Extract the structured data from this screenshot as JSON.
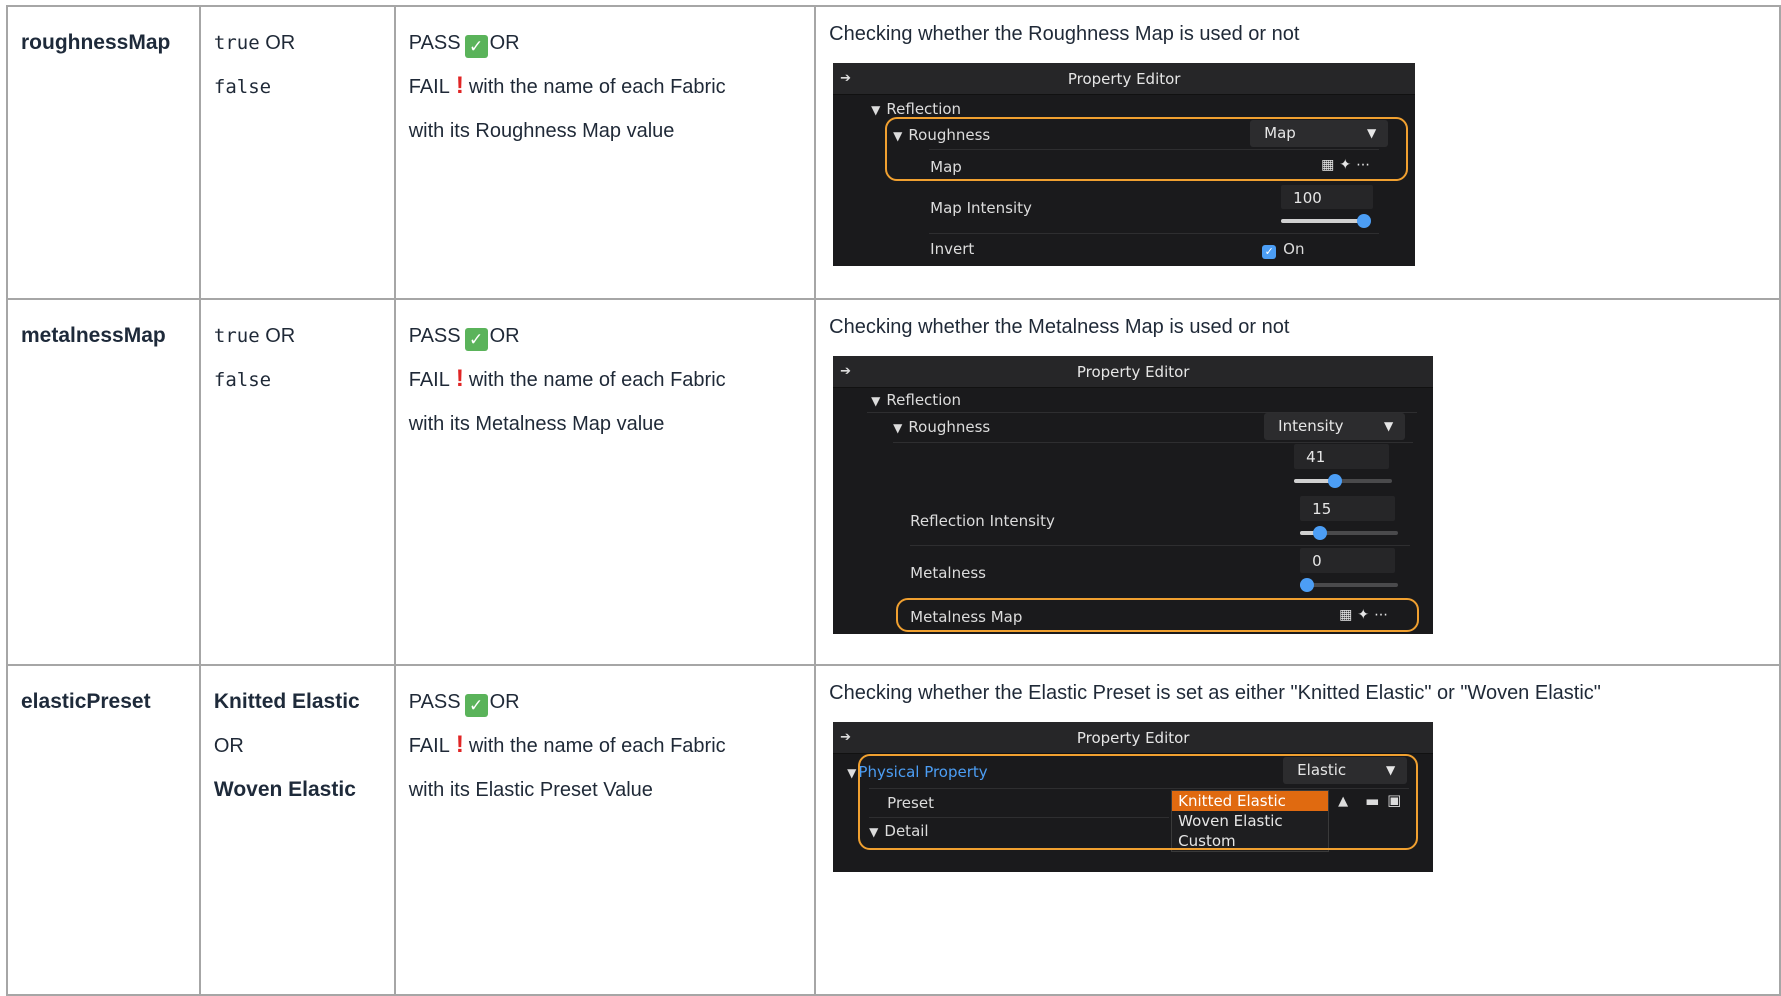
{
  "rows": [
    {
      "param": "roughnessMap",
      "values": [
        "true",
        "false"
      ],
      "or": "OR",
      "pass_label": "PASS",
      "fail_label": "FAIL",
      "result_line1_tail": "OR",
      "result_line2_tail": "with the name of each Fabric",
      "result_line3": "with its Roughness Map value",
      "description": "Checking whether the Roughness Map is used or not",
      "editor": {
        "title": "Property Editor",
        "reflection": "Reflection",
        "roughness": "Roughness",
        "roughness_mode": "Map",
        "map": "Map",
        "map_intensity": "Map Intensity",
        "map_intensity_value": "100",
        "map_intensity_level": 1.0,
        "invert": "Invert",
        "invert_state": "On"
      }
    },
    {
      "param": "metalnessMap",
      "values": [
        "true",
        "false"
      ],
      "or": "OR",
      "pass_label": "PASS",
      "fail_label": "FAIL",
      "result_line1_tail": "OR",
      "result_line2_tail": "with the name of each Fabric",
      "result_line3": "with its Metalness Map value",
      "description": "Checking whether the Metalness Map is used or not",
      "editor": {
        "title": "Property Editor",
        "reflection": "Reflection",
        "roughness": "Roughness",
        "roughness_mode": "Intensity",
        "roughness_value": "41",
        "roughness_level": 0.41,
        "reflection_intensity": "Reflection Intensity",
        "reflection_intensity_value": "15",
        "reflection_intensity_level": 0.15,
        "metalness": "Metalness",
        "metalness_value": "0",
        "metalness_level": 0.0,
        "metalness_map": "Metalness Map"
      }
    },
    {
      "param": "elasticPreset",
      "value1": "Knitted Elastic",
      "or": "OR",
      "value2": "Woven Elastic",
      "pass_label": "PASS",
      "fail_label": "FAIL",
      "result_line1_tail": "OR",
      "result_line2_tail": "with the name of each Fabric",
      "result_line3": "with its Elastic Preset Value",
      "description": "Checking whether the Elastic Preset  is set as either \"Knitted Elastic\" or \"Woven Elastic\"",
      "editor": {
        "title": "Property Editor",
        "physical_property": "Physical Property",
        "physical_mode": "Elastic",
        "preset": "Preset",
        "detail": "Detail",
        "preset_options": [
          "Knitted Elastic",
          "Woven Elastic",
          "Custom"
        ],
        "preset_selected": "Knitted Elastic"
      }
    }
  ],
  "icons": {
    "pass": "white-check-mark-icon",
    "fail": "exclamation-icon",
    "expand": "triangle-down-icon",
    "panel_arrow": "arrow-right-icon",
    "map_actions": [
      "grid-icon",
      "sparkle-icon",
      "more-icon"
    ],
    "preset_actions": [
      "arrow-up-icon",
      "folder-icon",
      "save-icon"
    ]
  },
  "colors": {
    "highlight": "#f0a030",
    "pass_green": "#5ab35a",
    "fail_red": "#e02424",
    "accent_blue": "#4c9ef5",
    "menu_selected": "#e06a10"
  }
}
